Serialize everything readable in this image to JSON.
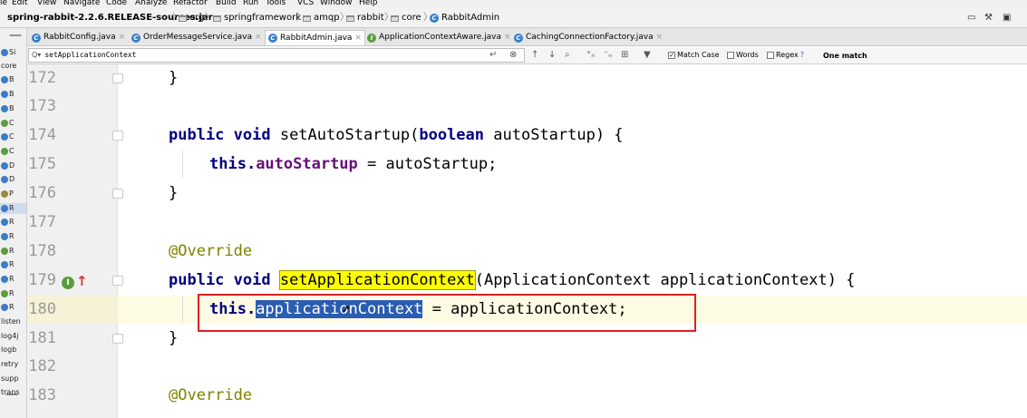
{
  "menu": [
    "le",
    "Edit",
    "View",
    "Navigate",
    "Code",
    "Analyze",
    "Refactor",
    "Build",
    "Run",
    "Tools",
    "VCS",
    "Window",
    "Help"
  ],
  "breadcrumb": {
    "project": "spring-rabbit-2.2.6.RELEASE-sources.jar",
    "items": [
      "org",
      "springframework",
      "amqp",
      "rabbit",
      "core"
    ],
    "current": "RabbitAdmin"
  },
  "tabs": [
    {
      "label": "RabbitConfig.java",
      "icon": "C",
      "active": false
    },
    {
      "label": "OrderMessageService.java",
      "icon": "C",
      "active": false
    },
    {
      "label": "RabbitAdmin.java",
      "icon": "C",
      "active": true
    },
    {
      "label": "ApplicationContextAware.java",
      "icon": "I",
      "active": false
    },
    {
      "label": "CachingConnectionFactory.java",
      "icon": "C",
      "active": false
    }
  ],
  "project_strip": [
    "Si",
    "core",
    "B",
    "B",
    "B",
    "C",
    "C",
    "C",
    "D",
    "D",
    "P",
    "R",
    "R",
    "R",
    "R",
    "R",
    "R",
    "R",
    "R",
    "R",
    "listen",
    "log4j",
    "logb",
    "retry",
    "supp",
    "trans"
  ],
  "search": {
    "query": "setApplicationContext",
    "match_case_label": "Match Case",
    "match_case_checked": true,
    "words_label": "Words",
    "words_checked": false,
    "regex_label": "Regex",
    "regex_help": "?",
    "result": "One match"
  },
  "lines": [
    {
      "num": "172",
      "text": "}"
    },
    {
      "num": "173",
      "text": ""
    },
    {
      "num": "174",
      "kw1": "public void",
      "text": " setAutoStartup(",
      "kw2": "boolean",
      "rest": " autoStartup) {"
    },
    {
      "num": "175",
      "kw1": "this.",
      "field": "autoStartup",
      "rest": " = autoStartup;"
    },
    {
      "num": "176",
      "text": "}"
    },
    {
      "num": "177",
      "text": ""
    },
    {
      "num": "178",
      "annotation": "@Override"
    },
    {
      "num": "179",
      "kw1": "public void",
      "highlight": "setApplicationContext",
      "rest": "(ApplicationContext applicationContext) {"
    },
    {
      "num": "180",
      "kw1": "this.",
      "selected": "applicationContext",
      "rest": " = applicationContext;"
    },
    {
      "num": "181",
      "text": "}"
    },
    {
      "num": "182",
      "text": ""
    },
    {
      "num": "183",
      "annotation": "@Override"
    }
  ],
  "colors": {
    "keyword": "#000080",
    "field": "#660e7a",
    "annotation": "#808000",
    "search_highlight": "#ffff00",
    "selection": "#2a5db0",
    "red_box": "#e02020"
  }
}
